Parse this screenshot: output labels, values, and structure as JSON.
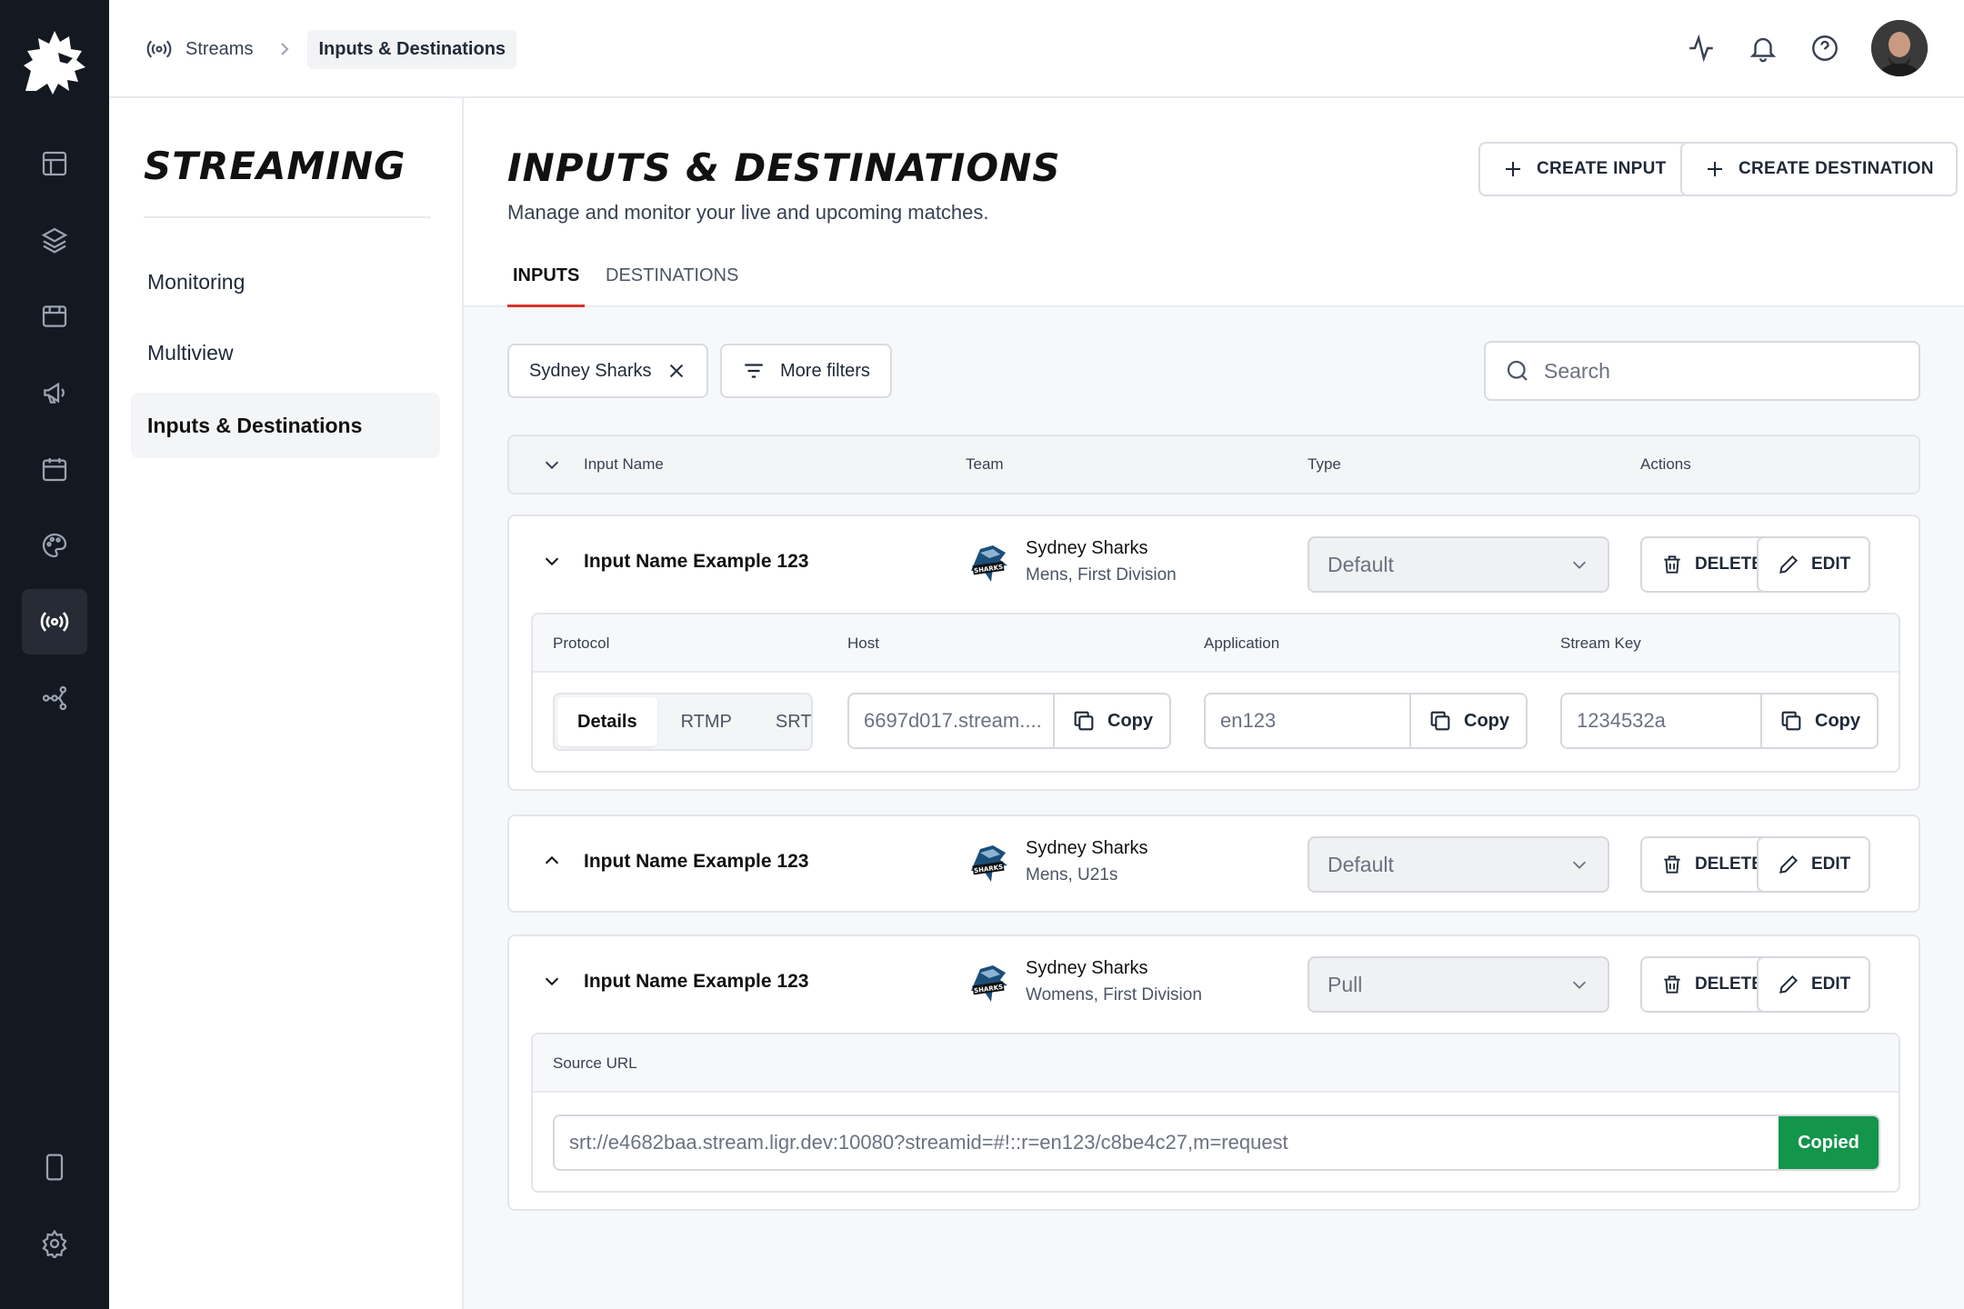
{
  "breadcrumb": {
    "root": "Streams",
    "current": "Inputs & Destinations"
  },
  "sidebar": {
    "title": "STREAMING",
    "items": [
      {
        "label": "Monitoring"
      },
      {
        "label": "Multiview"
      },
      {
        "label": "Inputs & Destinations"
      }
    ]
  },
  "page": {
    "title": "INPUTS & DESTINATIONS",
    "subtitle": "Manage and monitor your live and upcoming matches.",
    "create_input": "CREATE INPUT",
    "create_destination": "CREATE DESTINATION",
    "tabs": [
      {
        "label": "INPUTS"
      },
      {
        "label": "DESTINATIONS"
      }
    ]
  },
  "filters": {
    "chip": "Sydney Sharks",
    "more": "More filters",
    "search_placeholder": "Search"
  },
  "table": {
    "columns": {
      "name": "Input Name",
      "team": "Team",
      "type": "Type",
      "actions": "Actions"
    },
    "delete_label": "DELETE",
    "edit_label": "EDIT",
    "rows": [
      {
        "name": "Input Name Example 123",
        "team": "Sydney Sharks",
        "division": "Mens, First Division",
        "type": "Default"
      },
      {
        "name": "Input Name Example 123",
        "team": "Sydney Sharks",
        "division": "Mens, U21s",
        "type": "Default"
      },
      {
        "name": "Input Name Example 123",
        "team": "Sydney Sharks",
        "division": "Womens, First Division",
        "type": "Pull"
      }
    ]
  },
  "details": {
    "headers": {
      "protocol": "Protocol",
      "host": "Host",
      "application": "Application",
      "stream_key": "Stream Key"
    },
    "protocol_tabs": [
      "Details",
      "RTMP",
      "SRT"
    ],
    "host": "6697d017.stream....",
    "application": "en123",
    "stream_key": "1234532a",
    "copy_label": "Copy"
  },
  "source": {
    "header": "Source URL",
    "url": "srt://e4682baa.stream.ligr.dev:10080?streamid=#!::r=en123/c8be4c27,m=request",
    "copied_label": "Copied"
  },
  "colors": {
    "rail": "#141820",
    "accent_tab": "#d6332c",
    "copied_green": "#13954b"
  },
  "icons": [
    "lion-logo-icon",
    "layout-icon",
    "layers-icon",
    "browser-icon",
    "megaphone-icon",
    "calendar-icon",
    "palette-icon",
    "broadcast-icon",
    "flow-icon",
    "tablet-icon",
    "settings-icon",
    "activity-icon",
    "bell-icon",
    "help-icon",
    "plus-icon",
    "close-icon",
    "filter-icon",
    "search-icon",
    "chevron-down-icon",
    "chevron-up-icon",
    "trash-icon",
    "pencil-icon",
    "copy-icon"
  ]
}
